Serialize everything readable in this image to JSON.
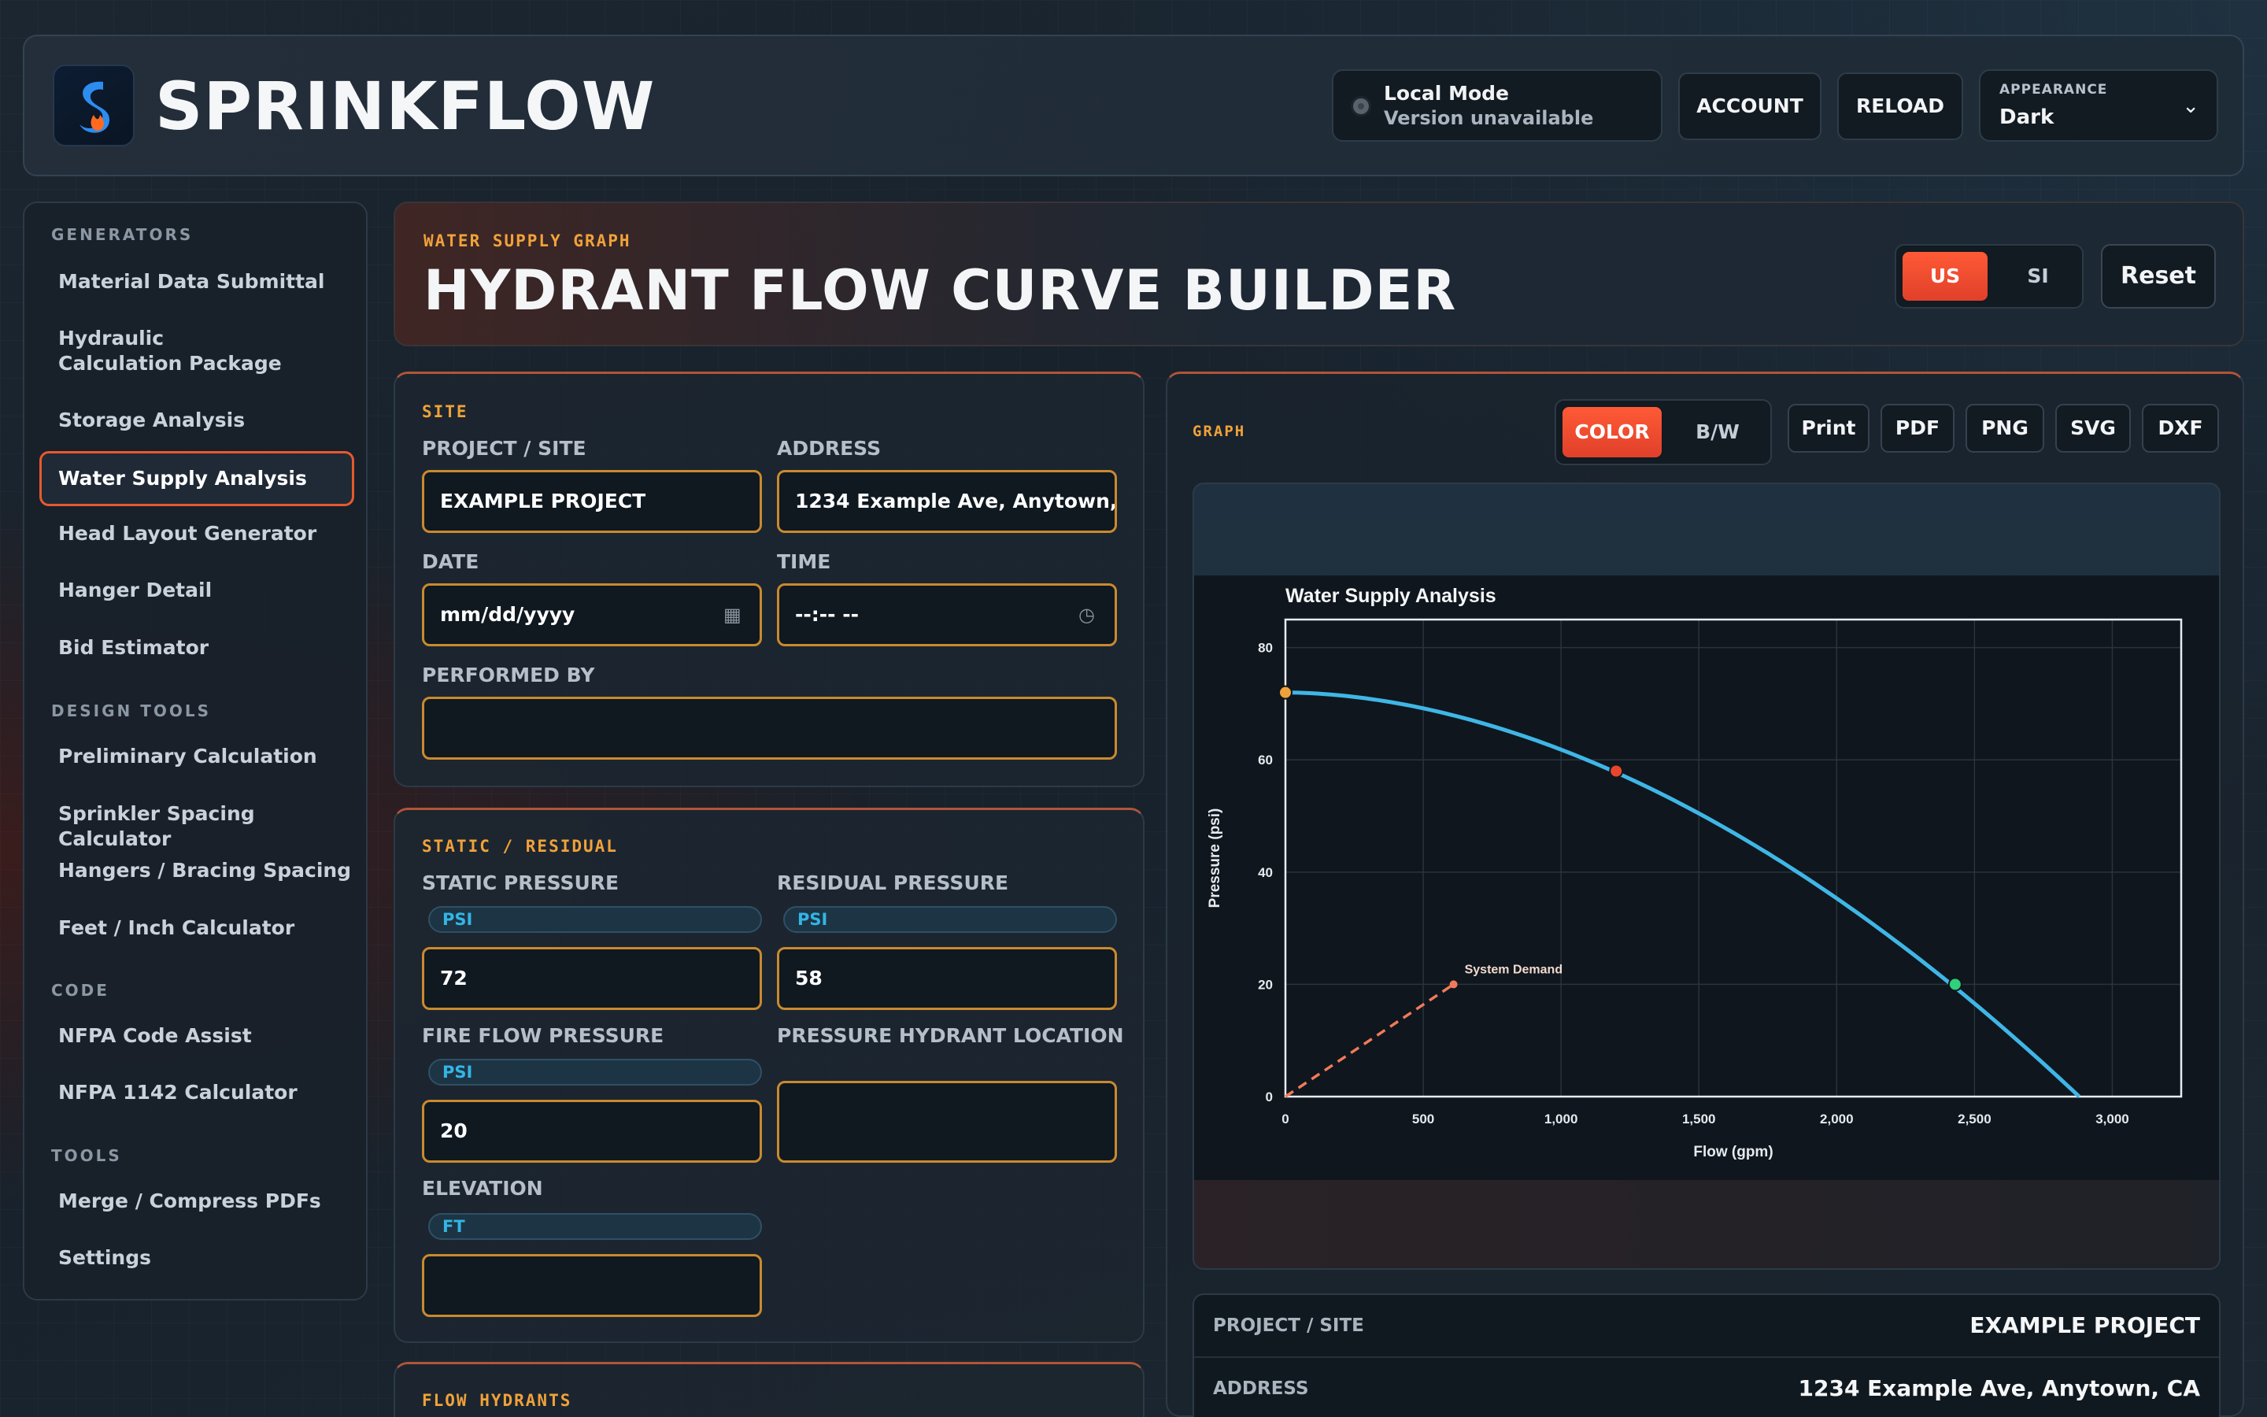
{
  "app": {
    "title": "SPRINKFLOW",
    "status_line1": "Local Mode",
    "status_line2": "Version unavailable",
    "account_label": "ACCOUNT",
    "reload_label": "RELOAD",
    "appearance_caption": "APPEARANCE",
    "appearance_value": "Dark"
  },
  "sidebar": {
    "sections": [
      {
        "title": "GENERATORS",
        "items": [
          "Material Data Submittal",
          "Hydraulic Calculation Package",
          "Storage Analysis",
          "Water Supply Analysis",
          "Head Layout Generator",
          "Hanger Detail",
          "Bid Estimator"
        ]
      },
      {
        "title": "DESIGN TOOLS",
        "items": [
          "Preliminary Calculation",
          "Sprinkler Spacing Calculator",
          "Hangers / Bracing Spacing",
          "Feet / Inch Calculator"
        ]
      },
      {
        "title": "CODE",
        "items": [
          "NFPA Code Assist",
          "NFPA 1142 Calculator"
        ]
      },
      {
        "title": "TOOLS",
        "items": [
          "Merge / Compress PDFs",
          "Settings"
        ]
      }
    ],
    "active": "Water Supply Analysis"
  },
  "page": {
    "kicker": "WATER SUPPLY GRAPH",
    "title": "HYDRANT FLOW CURVE BUILDER",
    "unit_us": "US",
    "unit_si": "SI",
    "reset_label": "Reset"
  },
  "site": {
    "section": "SITE",
    "project_label": "PROJECT / SITE",
    "project_value": "EXAMPLE PROJECT",
    "address_label": "ADDRESS",
    "address_value": "1234 Example Ave, Anytown, CA",
    "date_label": "DATE",
    "date_placeholder": "mm/dd/yyyy",
    "time_label": "TIME",
    "time_placeholder": "--:-- --",
    "performed_label": "PERFORMED BY",
    "performed_value": ""
  },
  "static_residual": {
    "section": "STATIC / RESIDUAL",
    "static_label": "STATIC PRESSURE",
    "static_unit": "PSI",
    "static_value": "72",
    "residual_label": "RESIDUAL PRESSURE",
    "residual_unit": "PSI",
    "residual_value": "58",
    "fire_flow_label": "FIRE FLOW PRESSURE",
    "fire_flow_unit": "PSI",
    "fire_flow_value": "20",
    "hydrant_location_label": "PRESSURE HYDRANT LOCATION",
    "hydrant_location_value": "",
    "elevation_label": "ELEVATION",
    "elevation_unit": "FT",
    "elevation_value": ""
  },
  "flow_hydrants": {
    "section": "FLOW HYDRANTS"
  },
  "graph": {
    "kicker": "GRAPH",
    "color_label": "COLOR",
    "bw_label": "B/W",
    "exports": [
      "Print",
      "PDF",
      "PNG",
      "SVG",
      "DXF"
    ]
  },
  "chart_data": {
    "type": "line",
    "title": "Water Supply Analysis",
    "xlabel": "Flow (gpm)",
    "ylabel": "Pressure (psi)",
    "xlim": [
      0,
      3250
    ],
    "ylim": [
      0,
      85
    ],
    "x_ticks": [
      "0",
      "500",
      "1,000",
      "1,500",
      "2,000",
      "2,500",
      "3,000"
    ],
    "x_tick_values": [
      0,
      500,
      1000,
      1500,
      2000,
      2500,
      3000
    ],
    "y_ticks": [
      "0",
      "20",
      "40",
      "60",
      "80"
    ],
    "y_tick_values": [
      0,
      20,
      40,
      60,
      80
    ],
    "grid": true,
    "supply_curve": {
      "color": "#3fb6e6",
      "static_psi": 72,
      "flow_at_zero_gpm": 2880
    },
    "points": [
      {
        "x": 0,
        "y": 72,
        "color": "#f0a23a"
      },
      {
        "x": 1200,
        "y": 58,
        "color": "#e8452d"
      },
      {
        "x": 2430,
        "y": 20,
        "color": "#2fd07a"
      }
    ],
    "demand": {
      "label": "System Demand",
      "x": [
        0,
        610
      ],
      "y": [
        0,
        20
      ],
      "color": "#f07a5a"
    }
  },
  "summary": [
    {
      "key": "PROJECT / SITE",
      "value": "EXAMPLE PROJECT"
    },
    {
      "key": "ADDRESS",
      "value": "1234 Example Ave, Anytown, CA"
    }
  ]
}
